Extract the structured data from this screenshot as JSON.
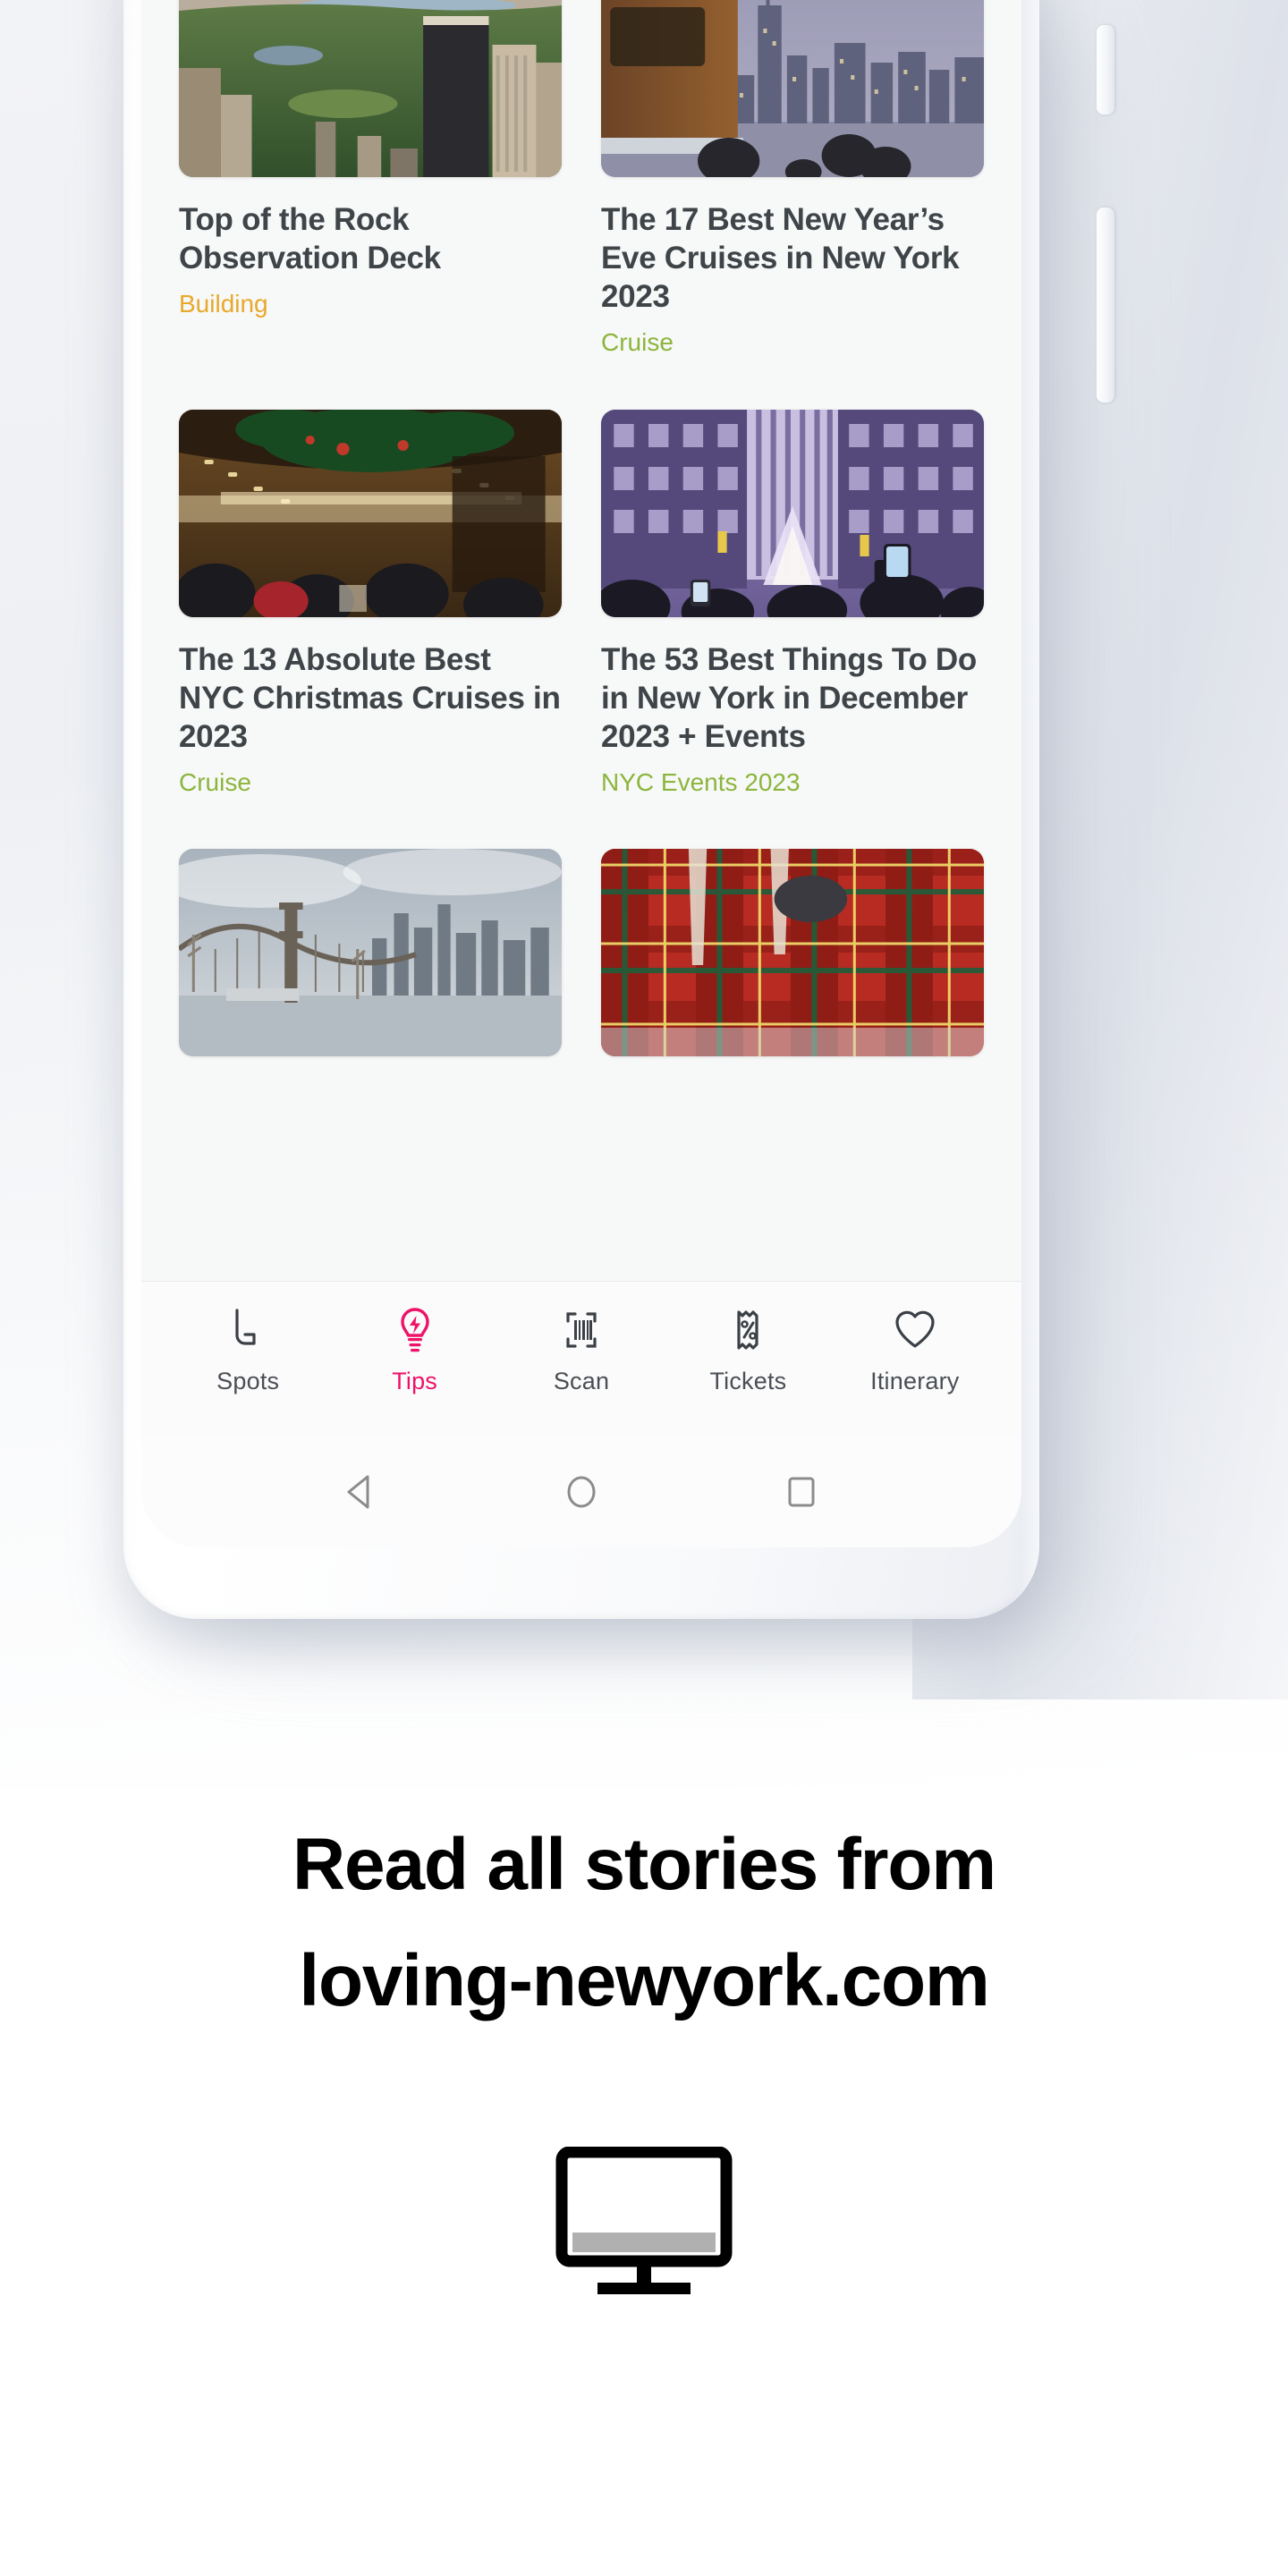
{
  "device": {
    "hardware": {
      "power_button": "power-button",
      "volume_button": "volume-button"
    }
  },
  "feed": {
    "cards": [
      {
        "title": "Top of the Rock Observation Deck",
        "category": "Building",
        "category_color": "#e8a92c",
        "image": "aerial-view-central-park-skyline"
      },
      {
        "title": "The 17 Best New Year’s Eve Cruises in New York 2023",
        "category": "Cruise",
        "category_color": "#8cb53c",
        "image": "boat-deck-nyc-skyline-dusk"
      },
      {
        "title": "The 13 Absolute Best NYC Christmas Cruises in 2023",
        "category": "Cruise",
        "category_color": "#8cb53c",
        "image": "christmas-decorated-boat-interior"
      },
      {
        "title": "The 53 Best Things To Do in New York in December 2023 + Events",
        "category": "NYC Events 2023",
        "category_color": "#8cb53c",
        "image": "rockefeller-center-christmas-tree-night"
      },
      {
        "title": "",
        "category": "",
        "category_color": "#8cb53c",
        "image": "brooklyn-bridge-winter-skyline"
      },
      {
        "title": "",
        "category": "",
        "category_color": "#8cb53c",
        "image": "red-tartan-plaid-clothing"
      }
    ]
  },
  "tabbar": {
    "active_color": "#ee1268",
    "inactive_color": "#4a4f55",
    "tabs": [
      {
        "label": "Spots",
        "icon": "location-pin-icon",
        "active": false
      },
      {
        "label": "Tips",
        "icon": "lightbulb-bolt-icon",
        "active": true
      },
      {
        "label": "Scan",
        "icon": "barcode-scan-icon",
        "active": false
      },
      {
        "label": "Tickets",
        "icon": "ticket-percent-icon",
        "active": false
      },
      {
        "label": "Itinerary",
        "icon": "heart-icon",
        "active": false
      }
    ]
  },
  "navbar": {
    "keys": [
      {
        "name": "back-key",
        "icon": "triangle-left-icon"
      },
      {
        "name": "home-key",
        "icon": "circle-icon"
      },
      {
        "name": "recents-key",
        "icon": "square-icon"
      }
    ]
  },
  "caption": {
    "line1": "Read all stories from",
    "line2": "loving-newyork.com",
    "icon": "desktop-monitor-icon"
  }
}
